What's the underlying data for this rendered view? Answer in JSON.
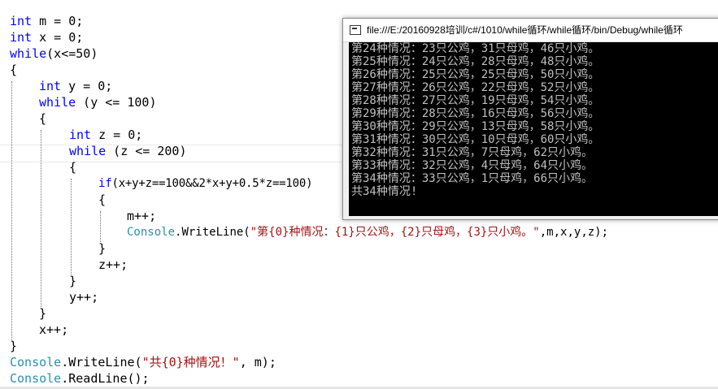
{
  "code": {
    "l01": {
      "kw": "int",
      "rest": " m = 0;"
    },
    "l02": {
      "kw": "int",
      "rest": " x = 0;"
    },
    "l03": {
      "kw": "while",
      "rest": "(x<=50)"
    },
    "l04": {
      "text": "{"
    },
    "l05": {
      "kw": "int",
      "rest": " y = 0;"
    },
    "l06": {
      "kw": "while",
      "rest": " (y <= 100)"
    },
    "l07": {
      "text": "{"
    },
    "l08": {
      "kw": "int",
      "rest": " z = 0;"
    },
    "l09": {
      "kw": "while",
      "rest": " (z <= 200)"
    },
    "l10": {
      "text": "{"
    },
    "l11": {
      "kw": "if",
      "rest": "(x+y+z==100&&2*x+y+0.5*z==100)"
    },
    "l12": {
      "text": "{"
    },
    "l13": {
      "text": "m++;"
    },
    "l14": {
      "type": "Console",
      "mid": ".WriteLine(",
      "str": "\"第{0}种情况：{1}只公鸡，{2}只母鸡，{3}只小鸡。\"",
      "rest": ",m,x,y,z);"
    },
    "l15": {
      "text": "}"
    },
    "l16": {
      "text": "z++;"
    },
    "l17": {
      "text": "}"
    },
    "l18": {
      "text": "y++;"
    },
    "l19": {
      "text": "}"
    },
    "l20": {
      "text": "x++;"
    },
    "l21": {
      "text": "}"
    },
    "l22": {
      "type": "Console",
      "mid": ".WriteLine(",
      "str": "\"共{0}种情况！\"",
      "rest": ", m);"
    },
    "l23": {
      "type": "Console",
      "mid": ".ReadLine();"
    }
  },
  "console": {
    "title": "file:///E:/20160928培训/c#/1010/while循环/while循环/bin/Debug/while循环",
    "lines": [
      "第24种情况：23只公鸡，31只母鸡，46只小鸡。",
      "第25种情况：24只公鸡，28只母鸡，48只小鸡。",
      "第26种情况：25只公鸡，25只母鸡，50只小鸡。",
      "第27种情况：26只公鸡，22只母鸡，52只小鸡。",
      "第28种情况：27只公鸡，19只母鸡，54只小鸡。",
      "第29种情况：28只公鸡，16只母鸡，56只小鸡。",
      "第30种情况：29只公鸡，13只母鸡，58只小鸡。",
      "第31种情况：30只公鸡，10只母鸡，60只小鸡。",
      "第32种情况：31只公鸡，7只母鸡，62只小鸡。",
      "第33种情况：32只公鸡，4只母鸡，64只小鸡。",
      "第34种情况：33只公鸡，1只母鸡，66只小鸡。",
      "共34种情况!"
    ]
  }
}
